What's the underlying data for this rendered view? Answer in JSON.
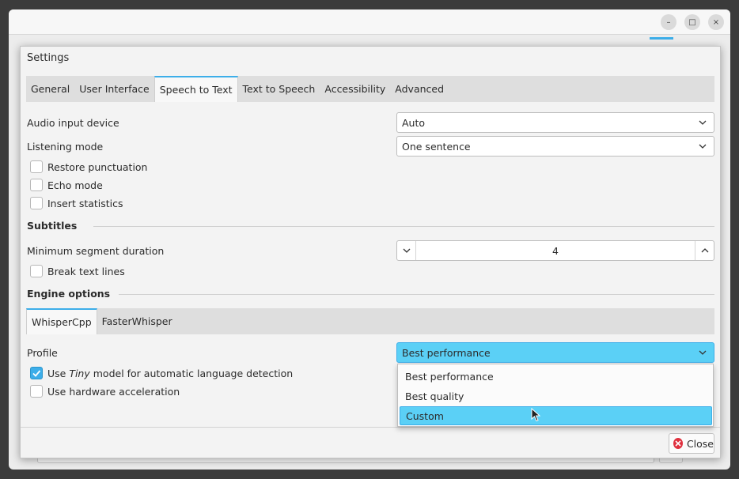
{
  "window": {
    "minimize_glyph": "–",
    "maximize_glyph": "□",
    "close_glyph": "×"
  },
  "dialog": {
    "title": "Settings",
    "tabs": [
      {
        "label": "General",
        "active": false
      },
      {
        "label": "User Interface",
        "active": false
      },
      {
        "label": "Speech to Text",
        "active": true
      },
      {
        "label": "Text to Speech",
        "active": false
      },
      {
        "label": "Accessibility",
        "active": false
      },
      {
        "label": "Advanced",
        "active": false
      }
    ],
    "audio_input_label": "Audio input device",
    "audio_input_value": "Auto",
    "listening_mode_label": "Listening mode",
    "listening_mode_value": "One sentence",
    "checkboxes": {
      "restore_punctuation": {
        "label": "Restore punctuation",
        "checked": false
      },
      "echo_mode": {
        "label": "Echo mode",
        "checked": false
      },
      "insert_statistics": {
        "label": "Insert statistics",
        "checked": false
      },
      "break_text_lines": {
        "label": "Break text lines",
        "checked": false
      },
      "use_tiny_pre": "Use ",
      "use_tiny_em": "Tiny",
      "use_tiny_post": " model for automatic language detection",
      "use_tiny_checked": true,
      "hw_accel": {
        "label": "Use hardware acceleration",
        "checked": false
      }
    },
    "subtitles_heading": "Subtitles",
    "min_segment_label": "Minimum segment duration",
    "min_segment_value": "4",
    "engine_heading": "Engine options",
    "engine_tabs": [
      {
        "label": "WhisperCpp",
        "active": true
      },
      {
        "label": "FasterWhisper",
        "active": false
      }
    ],
    "profile_label": "Profile",
    "profile_value": "Best performance",
    "profile_options": [
      "Best performance",
      "Best quality",
      "Custom"
    ],
    "profile_highlighted_option": "Custom",
    "close_label": "Close"
  },
  "colors": {
    "accent": "#3daee9",
    "highlight": "#5bd0f6",
    "close_icon": "#e0313f"
  },
  "icons": {
    "chevron": "chevron-down-icon",
    "spin_down": "chevron-down-icon",
    "spin_up": "chevron-up-icon",
    "check": "check-icon",
    "close": "close-circle-icon",
    "cursor": "mouse-pointer-icon"
  }
}
